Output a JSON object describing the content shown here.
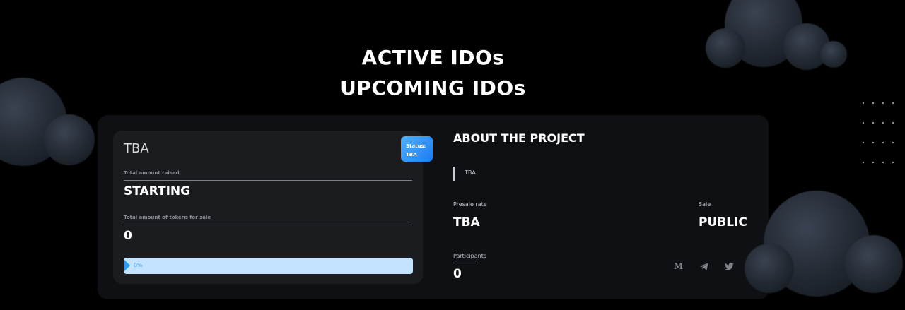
{
  "headings": {
    "active": "ACTIVE IDOs",
    "upcoming": "UPCOMING IDOs"
  },
  "card": {
    "project_name": "TBA",
    "status_label": "Status:",
    "status_value": "TBA",
    "raised_label": "Total amount raised",
    "raised_value": "STARTING",
    "tokens_label": "Total amount of tokens for sale",
    "tokens_value": "0",
    "progress_text": "0%",
    "progress_fraction": 0
  },
  "about": {
    "title": "ABOUT THE PROJECT",
    "description": "TBA",
    "presale_label": "Presale rate",
    "presale_value": "TBA",
    "sale_label": "Sale",
    "sale_value": "PUBLIC",
    "participants_label": "Participants",
    "participants_value": "0"
  },
  "social": {
    "medium": "M",
    "telegram_icon": "telegram-icon",
    "twitter_icon": "twitter-icon"
  },
  "colors": {
    "status_badge": "#2a9cf5",
    "progress_track": "#c3e3ff"
  }
}
